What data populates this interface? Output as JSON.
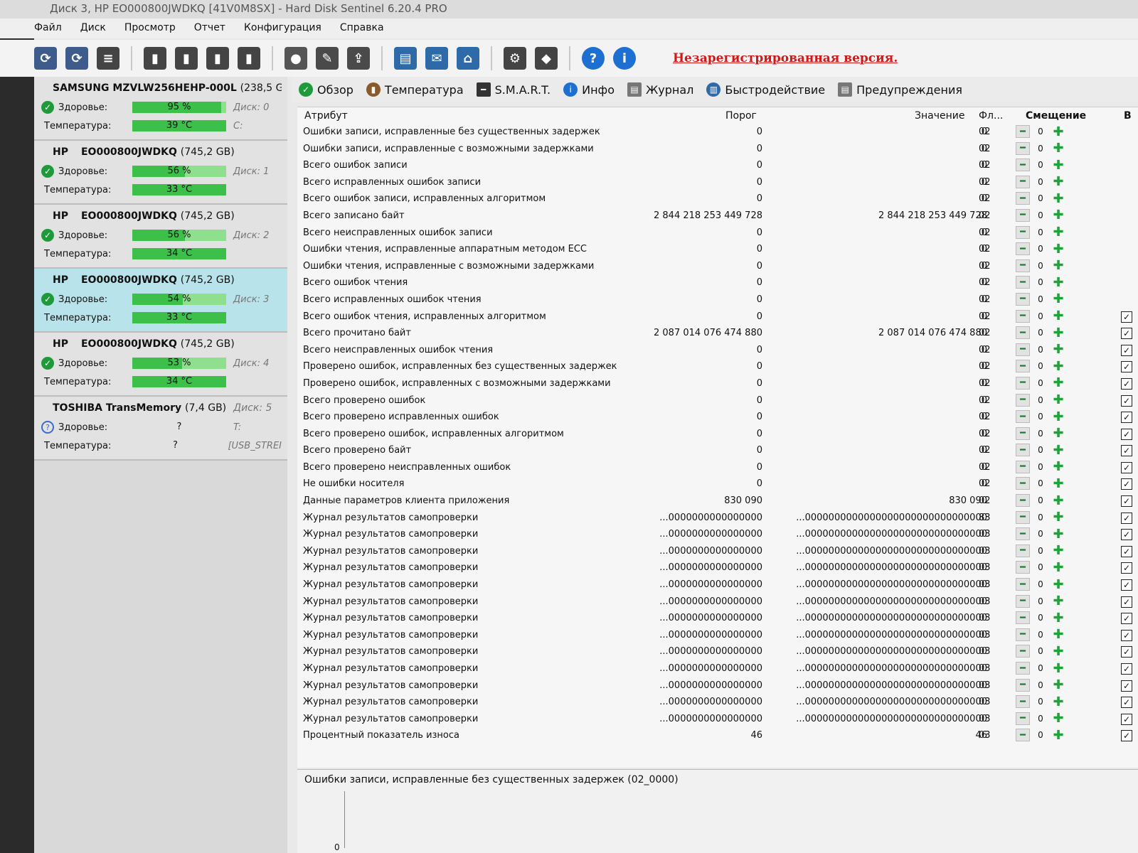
{
  "window": {
    "title": "Диск 3, HP   EO000800JWDKQ [41V0M8SX]  -  Hard Disk Sentinel 6.20.4 PRO"
  },
  "menu": [
    "Файл",
    "Диск",
    "Просмотр",
    "Отчет",
    "Конфигурация",
    "Справка"
  ],
  "toolbar": {
    "icons": [
      "refresh-icon",
      "refresh-all-icon",
      "list-icon",
      "disk-tool-1-icon",
      "disk-tool-2-icon",
      "disk-tool-3-icon",
      "disk-tool-4-icon",
      "hdd-icon",
      "wrench-icon",
      "backup-icon",
      "report-icon",
      "email-icon",
      "network-icon",
      "settings-icon",
      "shield-icon",
      "help-icon",
      "info-icon"
    ],
    "unregistered": "Незарегистрированная версия."
  },
  "disks": [
    {
      "model": "SAMSUNG MZVLW256HEHP-000L",
      "size": "(238,5 GI",
      "health_label": "Здоровье:",
      "health": "95 %",
      "health_pct": 95,
      "temp_label": "Температура:",
      "temp": "39 °C",
      "extra1": "Диск: 0",
      "extra2": "C:",
      "status": "ok"
    },
    {
      "vendor": "HP",
      "model": "EO000800JWDKQ",
      "size": "(745,2 GB)",
      "health_label": "Здоровье:",
      "health": "56 %",
      "health_pct": 56,
      "temp_label": "Температура:",
      "temp": "33 °C",
      "extra1": "Диск: 1",
      "extra2": "",
      "status": "ok"
    },
    {
      "vendor": "HP",
      "model": "EO000800JWDKQ",
      "size": "(745,2 GB)",
      "health_label": "Здоровье:",
      "health": "56 %",
      "health_pct": 56,
      "temp_label": "Температура:",
      "temp": "34 °C",
      "extra1": "Диск: 2",
      "extra2": "",
      "status": "ok"
    },
    {
      "vendor": "HP",
      "model": "EO000800JWDKQ",
      "size": "(745,2 GB)",
      "health_label": "Здоровье:",
      "health": "54 %",
      "health_pct": 54,
      "temp_label": "Температура:",
      "temp": "33 °C",
      "extra1": "Диск: 3",
      "extra2": "",
      "status": "ok",
      "selected": true
    },
    {
      "vendor": "HP",
      "model": "EO000800JWDKQ",
      "size": "(745,2 GB)",
      "health_label": "Здоровье:",
      "health": "53 %",
      "health_pct": 53,
      "temp_label": "Температура:",
      "temp": "34 °C",
      "extra1": "Диск: 4",
      "extra2": "",
      "status": "ok"
    },
    {
      "model": "TOSHIBA TransMemory",
      "size": "(7,4 GB)",
      "disk_no": "Диск: 5",
      "health_label": "Здоровье:",
      "health": "?",
      "temp_label": "Температура:",
      "temp": "?",
      "extra1": "T:",
      "extra2": "[USB_STREI",
      "status": "unknown"
    }
  ],
  "tabs": [
    {
      "label": "Обзор",
      "icon": "check-circle-icon"
    },
    {
      "label": "Температура",
      "icon": "thermometer-icon"
    },
    {
      "label": "S.M.A.R.T.",
      "icon": "smart-icon"
    },
    {
      "label": "Инфо",
      "icon": "info-icon"
    },
    {
      "label": "Журнал",
      "icon": "log-icon"
    },
    {
      "label": "Быстродействие",
      "icon": "performance-icon"
    },
    {
      "label": "Предупреждения",
      "icon": "alerts-icon"
    }
  ],
  "table": {
    "headers": {
      "attribute": "Атрибут",
      "threshold": "Порог",
      "value": "Значение",
      "flags": "Фл...",
      "offset": "Смещение",
      "extra": "В"
    },
    "rows": [
      {
        "name": "Ошибки записи, исправленные без существенных задержек",
        "threshold": "0",
        "value": "0",
        "flags": "02",
        "offset": "0"
      },
      {
        "name": "Ошибки записи, исправленные с возможными задержками",
        "threshold": "0",
        "value": "0",
        "flags": "02",
        "offset": "0"
      },
      {
        "name": "Всего ошибок записи",
        "threshold": "0",
        "value": "0",
        "flags": "02",
        "offset": "0"
      },
      {
        "name": "Всего исправленных ошибок записи",
        "threshold": "0",
        "value": "0",
        "flags": "02",
        "offset": "0"
      },
      {
        "name": "Всего ошибок записи, исправленных алгоритмом",
        "threshold": "0",
        "value": "0",
        "flags": "02",
        "offset": "0"
      },
      {
        "name": "Всего записано байт",
        "threshold": "2 844 218 253 449 728",
        "value": "2 844 218 253 449 728",
        "flags": "02",
        "offset": "0"
      },
      {
        "name": "Всего неисправленных ошибок записи",
        "threshold": "0",
        "value": "0",
        "flags": "02",
        "offset": "0"
      },
      {
        "name": "Ошибки чтения, исправленные аппаратным методом ECC",
        "threshold": "0",
        "value": "0",
        "flags": "02",
        "offset": "0"
      },
      {
        "name": "Ошибки чтения, исправленные с возможными задержками",
        "threshold": "0",
        "value": "0",
        "flags": "02",
        "offset": "0"
      },
      {
        "name": "Всего ошибок чтения",
        "threshold": "0",
        "value": "0",
        "flags": "02",
        "offset": "0"
      },
      {
        "name": "Всего исправленных ошибок чтения",
        "threshold": "0",
        "value": "0",
        "flags": "02",
        "offset": "0"
      },
      {
        "name": "Всего ошибок чтения, исправленных алгоритмом",
        "threshold": "0",
        "value": "0",
        "flags": "02",
        "offset": "0"
      },
      {
        "name": "Всего прочитано байт",
        "threshold": "2 087 014 076 474 880",
        "value": "2 087 014 076 474 880",
        "flags": "02",
        "offset": "0"
      },
      {
        "name": "Всего неисправленных ошибок чтения",
        "threshold": "0",
        "value": "0",
        "flags": "02",
        "offset": "0"
      },
      {
        "name": "Проверено ошибок, исправленных без существенных задержек",
        "threshold": "0",
        "value": "0",
        "flags": "02",
        "offset": "0"
      },
      {
        "name": "Проверено ошибок, исправленных с возможными задержками",
        "threshold": "0",
        "value": "0",
        "flags": "02",
        "offset": "0"
      },
      {
        "name": "Всего проверено ошибок",
        "threshold": "0",
        "value": "0",
        "flags": "02",
        "offset": "0"
      },
      {
        "name": "Всего проверено исправленных ошибок",
        "threshold": "0",
        "value": "0",
        "flags": "02",
        "offset": "0"
      },
      {
        "name": "Всего проверено ошибок, исправленных алгоритмом",
        "threshold": "0",
        "value": "0",
        "flags": "02",
        "offset": "0"
      },
      {
        "name": "Всего проверено байт",
        "threshold": "0",
        "value": "0",
        "flags": "02",
        "offset": "0"
      },
      {
        "name": "Всего проверено неисправленных ошибок",
        "threshold": "0",
        "value": "0",
        "flags": "02",
        "offset": "0"
      },
      {
        "name": "Не ошибки носителя",
        "threshold": "0",
        "value": "0",
        "flags": "02",
        "offset": "0"
      },
      {
        "name": "Данные параметров клиента приложения",
        "threshold": "830 090",
        "value": "830 090",
        "flags": "02",
        "offset": "0"
      },
      {
        "name": "Журнал результатов самопроверки",
        "threshold": "...0000000000000000",
        "value": "...0000000000000000000000000000000",
        "flags": "83",
        "offset": "0"
      },
      {
        "name": "Журнал результатов самопроверки",
        "threshold": "...0000000000000000",
        "value": "...0000000000000000000000000000000",
        "flags": "03",
        "offset": "0"
      },
      {
        "name": "Журнал результатов самопроверки",
        "threshold": "...0000000000000000",
        "value": "...0000000000000000000000000000000",
        "flags": "03",
        "offset": "0"
      },
      {
        "name": "Журнал результатов самопроверки",
        "threshold": "...0000000000000000",
        "value": "...0000000000000000000000000000000",
        "flags": "03",
        "offset": "0"
      },
      {
        "name": "Журнал результатов самопроверки",
        "threshold": "...0000000000000000",
        "value": "...0000000000000000000000000000000",
        "flags": "03",
        "offset": "0"
      },
      {
        "name": "Журнал результатов самопроверки",
        "threshold": "...0000000000000000",
        "value": "...0000000000000000000000000000000",
        "flags": "03",
        "offset": "0"
      },
      {
        "name": "Журнал результатов самопроверки",
        "threshold": "...0000000000000000",
        "value": "...0000000000000000000000000000000",
        "flags": "03",
        "offset": "0"
      },
      {
        "name": "Журнал результатов самопроверки",
        "threshold": "...0000000000000000",
        "value": "...0000000000000000000000000000000",
        "flags": "03",
        "offset": "0"
      },
      {
        "name": "Журнал результатов самопроверки",
        "threshold": "...0000000000000000",
        "value": "...0000000000000000000000000000000",
        "flags": "03",
        "offset": "0"
      },
      {
        "name": "Журнал результатов самопроверки",
        "threshold": "...0000000000000000",
        "value": "...0000000000000000000000000000000",
        "flags": "03",
        "offset": "0"
      },
      {
        "name": "Журнал результатов самопроверки",
        "threshold": "...0000000000000000",
        "value": "...0000000000000000000000000000000",
        "flags": "03",
        "offset": "0"
      },
      {
        "name": "Журнал результатов самопроверки",
        "threshold": "...0000000000000000",
        "value": "...0000000000000000000000000000000",
        "flags": "03",
        "offset": "0"
      },
      {
        "name": "Журнал результатов самопроверки",
        "threshold": "...0000000000000000",
        "value": "...0000000000000000000000000000000",
        "flags": "03",
        "offset": "0"
      },
      {
        "name": "Процентный показатель износа",
        "threshold": "46",
        "value": "46",
        "flags": "03",
        "offset": "0"
      }
    ]
  },
  "bottom": {
    "title": "Ошибки записи, исправленные без существенных задержек (02_0000)",
    "axis_zero": "0"
  },
  "colors": {
    "health_fill": "#3cc04a",
    "unregistered": "#d01818",
    "selected_disk": "#b9e3ea"
  }
}
